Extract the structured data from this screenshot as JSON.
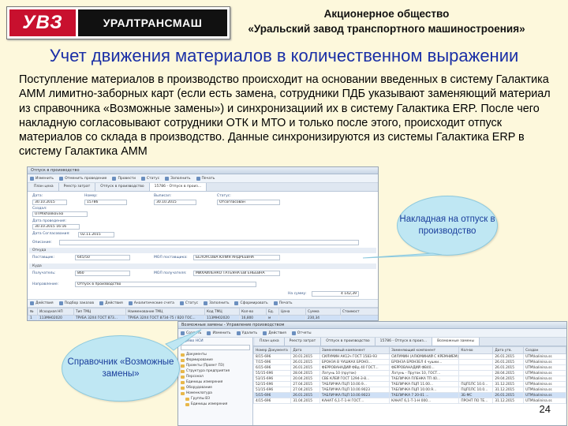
{
  "header": {
    "logo_mark": "УВЗ",
    "logo_name": "УРАЛТРАНСМАШ",
    "company_line1": "Акционерное общество",
    "company_line2": "«Уральский завод транспортного машиностроения»"
  },
  "slide": {
    "title": "Учет движения материалов в количественном выражении",
    "intro": "Поступление материалов в производство происходит на основании введенных в систему Галактика АММ лимитно-заборных карт (если есть замена, сотрудники ПДБ указывают заменяющий материал из справочника «Возможные замены») и синхронизациий их в систему Галактика ERP. После чего накладную согласовывают сотрудники ОТК и МТО и только после этого, происходит отпуск материалов со склада в производство. Данные синхронизируются из системы Галактика ERP в систему Галактика АММ",
    "page_number": "24"
  },
  "callouts": {
    "invoice": "Накладная на отпуск в производство",
    "replacements": "Справочник «Возможные замены»"
  },
  "screen1": {
    "window_title": "Отпуск в производство",
    "toolbar": [
      "Изменить",
      "Отменить проведение",
      "Провести",
      "Статус",
      "Заполнить",
      "Печать"
    ],
    "tabs": [
      "План цеха",
      "Реестр затрат",
      "Отпуск в производство",
      "15786 - Отпуск в произ..."
    ],
    "labels": {
      "date": "Дата:",
      "number": "Номер:",
      "issued": "Выписал:",
      "status": "Статус:",
      "created_by": "Создал:",
      "date_post": "Дата проведения:",
      "date_agree": "Дата Согласования:",
      "description": "Описание:",
      "from": "Откуда",
      "supplier": "Поставщик:",
      "mol_supplier": "МОЛ поставщика:",
      "to": "Куда",
      "receiver": "Получатель:",
      "mol_receiver": "МОЛ получателя:",
      "direction": "Направление:",
      "sum": "На сумму:"
    },
    "values": {
      "date": "30.10.2015",
      "number": "15786",
      "issued": "30.10.2015",
      "status": "Отсогласован",
      "created_by": "UTM\\khalikov.ko",
      "date_post": "30.10.2015 16:16",
      "date_agree": "02.11.2015",
      "supplier": "645/50",
      "mol_supplier": "БЕЛОУСОВА ЮЛИЯ АНДРЕЕВНА",
      "receiver": "860",
      "mol_receiver": "МИХАЙЛЕНКО ТАТЬЯНА ЕВГЕНЬЕВНА",
      "direction": "Отпуск в производство",
      "sum": "4 142,39"
    },
    "grid_toolbar": [
      "Действия",
      "Подбор заказов",
      "Действия",
      "Аналитические счета",
      "Статус",
      "Заполнить",
      "Сформировать",
      "Печать"
    ],
    "columns": [
      "№",
      "Исходная НП",
      "Тип ТМЦ",
      "Наименование ТМЦ",
      "Код ТМЦ",
      "Кол-во",
      "Ед.",
      "Цена",
      "Сумма",
      "Стоимост"
    ],
    "rows": [
      [
        "1",
        "113МН02020",
        "ТРУБА 32Х4 ГОСТ 873...",
        "ТРУБА 32Х4 ГОСТ 8734-75 / В20 ГОС...",
        "113МН02020",
        "16,800",
        "м",
        "",
        "230,34",
        ""
      ]
    ]
  },
  "screen2": {
    "window_title": "Возможные замены - Управление производством",
    "toolbar": [
      "Создать",
      "Изменить",
      "Удалить",
      "Действия",
      "Отчеты"
    ],
    "tabs": [
      "План цеха",
      "Реестр затрат",
      "Отпуск в производство",
      "15786 - Отпуск в произ...",
      "Возможные замены"
    ],
    "tree_title": "Дерево НСИ",
    "tree": [
      {
        "label": "Документы",
        "level": 1
      },
      {
        "label": "Формирование",
        "level": 1
      },
      {
        "label": "Проекты (Проект ПЗ)",
        "level": 1
      },
      {
        "label": "Структура предприятия",
        "level": 1
      },
      {
        "label": "Персонал",
        "level": 1
      },
      {
        "label": "Единицы измерения",
        "level": 1
      },
      {
        "label": "Оборудование",
        "level": 1
      },
      {
        "label": "Номенклатура",
        "level": 1
      },
      {
        "label": "Группы ВЗ",
        "level": 2
      },
      {
        "label": "Единицы измерения",
        "level": 2
      }
    ],
    "columns": [
      "Номер Документа",
      "Дата",
      "Заменяемый компонент",
      "Заменяющий компонент",
      "Кол-во",
      "Дата утв.",
      "Создан"
    ],
    "rows": [
      [
        "8/15-696",
        "20.01.2015",
        "СИЛУМИН АК12ч ГОСТ 1583-93",
        "СИЛУМИН (АЛЮМИНИЙ С КРЕМНИЕМ)",
        "",
        "26.01.2015",
        "UTM\\kalinina.ss"
      ],
      [
        "7/15-696",
        "26.01.2015",
        "БРОНЗА В ЧУШКАХ БРОНЗ...",
        "БРОНЗА БРОНЗЕЛ 4 чушки...",
        "",
        "26.01.2015",
        "UTM\\kalinina.ss"
      ],
      [
        "6/15-696",
        "26.01.2015",
        "ФЕРРОВАНАДИЙ ФВд 40 ГОСТ...",
        "ФЕРРОВАНАДИЙ ФВ40...",
        "",
        "26.01.2015",
        "UTM\\kalinina.ss"
      ],
      [
        "55/15-696",
        "28.04.2015",
        "Латунь 10 (пруток)",
        "Латунь - Пруток 10, ГОСТ...",
        "",
        "28.04.2015",
        "UTM\\kalinina.ss"
      ],
      [
        "53/15-696",
        "20.04.2015",
        "СВЕ КЛЕЙ ГОСТ 1294-3-8...",
        "ТАБЛИЧКА ПЛЕНКА ТП 40...",
        "",
        "29.04.2015",
        "UTM\\kalinina.ss"
      ],
      [
        "52/15-696",
        "27.04.2015",
        "ТАБЛИЧКА ПЦП 10.00.9...",
        "ТАБЛИЧКА ПЦП 11.00...",
        "ПЦП1ПС 10.0...",
        "31.12.2015",
        "UTM\\kalinina.ss"
      ],
      [
        "51/15-696",
        "27.04.2015",
        "ТАБЛИЧКА ПЦП 10.00.9023",
        "ТАБЛИЧКА ПЦП 10.00.9...",
        "ПЦП1ПС 10.0...",
        "31.12.2015",
        "UTM\\kalinina.ss"
      ],
      [
        "5/15-696",
        "26.01.2015",
        "ТАБЛИЧКА ПЦП 10.00.9023",
        "ТАБЛИЧКА 7 20-01 ...",
        "3Б-МС",
        "26.01.2015",
        "UTM\\kalinina.ss"
      ],
      [
        "4/15-696",
        "31.04.2015",
        "КАНАТ 6,1-Т-1-Н ГОСТ...",
        "КАНАТ 6,1-Т-1-Н 000...",
        "ПРОНТ ПО ТЕ...",
        "31.12.2015",
        "UTM\\kalinina.ss"
      ]
    ]
  }
}
